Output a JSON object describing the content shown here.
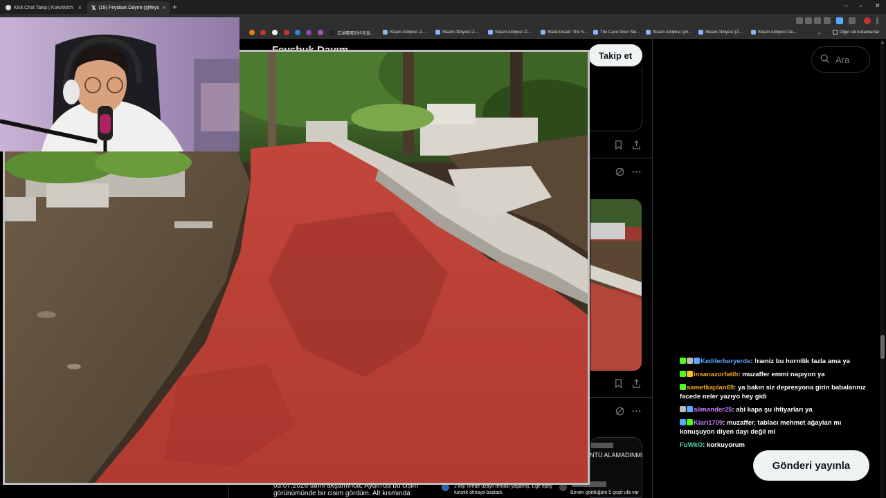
{
  "browser": {
    "tabs": [
      {
        "title": "Kick Chat Takip | KokoWich"
      },
      {
        "title": "(19) Feysbuk Dayım (@feysbukdayim) / X"
      }
    ],
    "new_tab_icon": "plus-icon",
    "bookmarks": [
      {
        "label": "江湖蛋蛋的抖音直..."
      },
      {
        "label": "Steam Atölyesi::Z-..."
      },
      {
        "label": "Steam Atölyesi::Z-..."
      },
      {
        "label": "Steam Atölyesi::Z-..."
      },
      {
        "label": "Static Dread: The S..."
      },
      {
        "label": "The Cave Diver Ste..."
      },
      {
        "label": "Steam Atölyesi::gm..."
      },
      {
        "label": "Steam Atölyesi::[Z-..."
      },
      {
        "label": "Steam Atölyesi::De..."
      }
    ],
    "other_bookmarks": "Diğer sık kullanılanlar"
  },
  "x": {
    "profile_name": "Feysbuk Dayım",
    "follow_label": "Takip et",
    "search_placeholder": "Ara",
    "post_button": "Gönderi yayınla",
    "tweet_snippet_right": "NTÜ ALAMADINMI",
    "bottom_left_text_1": "03.07.2026 tarihi akşamında, Aydın'da bu cisim",
    "bottom_left_text_2": "görünümünde bir cisim gördüm. Alt kısmında",
    "bottom_mid_text_1": "2 kişi Tirede uzaylı teması yaşamış. Ege epey",
    "bottom_mid_text_2": "turistik olmaya başladı.",
    "bottom_right_text": "Benim gördüğüm 5 çeşit ufa var"
  },
  "chat": {
    "messages": [
      {
        "user": "Kedilerheryerde",
        "user_color": "#5aa8ff",
        "text": "!ramiz bu hornilik fazla ama ya"
      },
      {
        "user": "insanazorfatih",
        "user_color": "#f5a623",
        "text": "muzaffer emmi napıyon ya"
      },
      {
        "user": "sametkaplan69",
        "user_color": "#f5a623",
        "text": "ya bakın siz depresyona girin babalarınız facede neler yazıyo hey gidi"
      },
      {
        "user": "alimander25",
        "user_color": "#c77dff",
        "text": "abi kapa şu ihtiyarları ya"
      },
      {
        "user": "Kiari1709",
        "user_color": "#c77dff",
        "text": "muzaffer, tablacı mehmet ağaylan mı konuşuyon diyen dayı değil mi"
      },
      {
        "user": "FuWkO",
        "user_color": "#4ed6a6",
        "text": "korkuyorum"
      }
    ]
  }
}
